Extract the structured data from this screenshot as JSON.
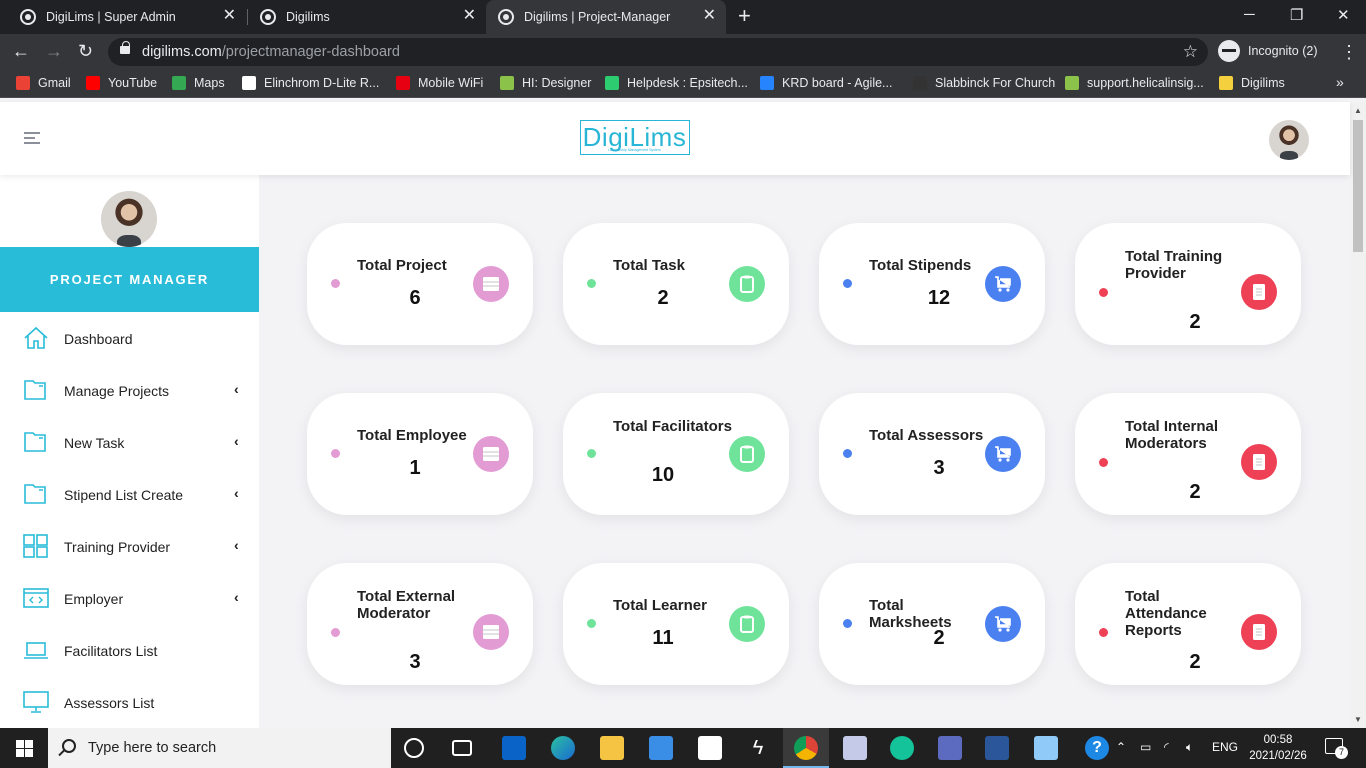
{
  "browser": {
    "tabs": [
      {
        "title": "DigiLims | Super Admin",
        "active": false
      },
      {
        "title": "Digilims",
        "active": false
      },
      {
        "title": "Digilims | Project-Manager",
        "active": true
      }
    ],
    "url_domain": "digilims.com",
    "url_path": "/projectmanager-dashboard",
    "profile_label": "Incognito (2)",
    "bookmarks": [
      {
        "label": "Gmail",
        "icon": "gmail-icon",
        "color": "#ea4335"
      },
      {
        "label": "YouTube",
        "icon": "youtube-icon",
        "color": "#ff0000"
      },
      {
        "label": "Maps",
        "icon": "maps-icon",
        "color": "#34a853"
      },
      {
        "label": "Elinchrom D-Lite R...",
        "icon": "elinchrom-icon",
        "color": "#ffffff"
      },
      {
        "label": "Mobile WiFi",
        "icon": "huawei-icon",
        "color": "#e60012"
      },
      {
        "label": "HI: Designer",
        "icon": "designer-icon",
        "color": "#8bc34a"
      },
      {
        "label": "Helpdesk : Epsitech...",
        "icon": "helpdesk-icon",
        "color": "#2ecc71"
      },
      {
        "label": "KRD board - Agile...",
        "icon": "jira-icon",
        "color": "#2684ff"
      },
      {
        "label": "Slabbinck For Church",
        "icon": "slabbinck-icon",
        "color": "#333333"
      },
      {
        "label": "support.helicalinsig...",
        "icon": "helical-icon",
        "color": "#8bc34a"
      },
      {
        "label": "Digilims",
        "icon": "folder-icon",
        "color": "#f4d03f"
      }
    ]
  },
  "header": {
    "logo_text": "DigiLims",
    "logo_subtext": "Learnership Management System"
  },
  "sidebar": {
    "role": "PROJECT MANAGER",
    "items": [
      {
        "label": "Dashboard",
        "icon": "home-icon",
        "has_submenu": false
      },
      {
        "label": "Manage Projects",
        "icon": "folder-icon",
        "has_submenu": true
      },
      {
        "label": "New Task",
        "icon": "folder-icon",
        "has_submenu": true
      },
      {
        "label": "Stipend List Create",
        "icon": "folder-icon",
        "has_submenu": true
      },
      {
        "label": "Training Provider",
        "icon": "grid-icon",
        "has_submenu": true
      },
      {
        "label": "Employer",
        "icon": "code-window-icon",
        "has_submenu": true
      },
      {
        "label": "Facilitators List",
        "icon": "laptop-icon",
        "has_submenu": false
      },
      {
        "label": "Assessors List",
        "icon": "monitor-icon",
        "has_submenu": false
      }
    ]
  },
  "colors": {
    "accent": "#29bcd9",
    "pink": "#e39bd4",
    "green": "#6fe39a",
    "blue": "#4a80f0",
    "red": "#ee4155"
  },
  "cards": [
    {
      "title": "Total Project",
      "value": "6",
      "color": "pink",
      "icon": "table-icon"
    },
    {
      "title": "Total Task",
      "value": "2",
      "color": "green",
      "icon": "clipboard-icon"
    },
    {
      "title": "Total Stipends",
      "value": "12",
      "color": "blue",
      "icon": "cart-icon"
    },
    {
      "title": "Total Training Provider",
      "value": "2",
      "color": "red",
      "icon": "document-icon"
    },
    {
      "title": "Total Employee",
      "value": "1",
      "color": "pink",
      "icon": "table-icon"
    },
    {
      "title": "Total Facilitators",
      "value": "10",
      "color": "green",
      "icon": "clipboard-icon"
    },
    {
      "title": "Total Assessors",
      "value": "3",
      "color": "blue",
      "icon": "cart-icon"
    },
    {
      "title": "Total Internal Moderators",
      "value": "2",
      "color": "red",
      "icon": "document-icon"
    },
    {
      "title": "Total External Moderator",
      "value": "3",
      "color": "pink",
      "icon": "table-icon"
    },
    {
      "title": "Total Learner",
      "value": "11",
      "color": "green",
      "icon": "clipboard-icon"
    },
    {
      "title": "Total Marksheets",
      "value": "2",
      "color": "blue",
      "icon": "cart-icon"
    },
    {
      "title": "Total Attendance Reports",
      "value": "2",
      "color": "red",
      "icon": "document-icon"
    }
  ],
  "taskbar": {
    "search_placeholder": "Type here to search",
    "language": "ENG",
    "time": "00:58",
    "date": "2021/02/26",
    "notification_count": "7"
  }
}
